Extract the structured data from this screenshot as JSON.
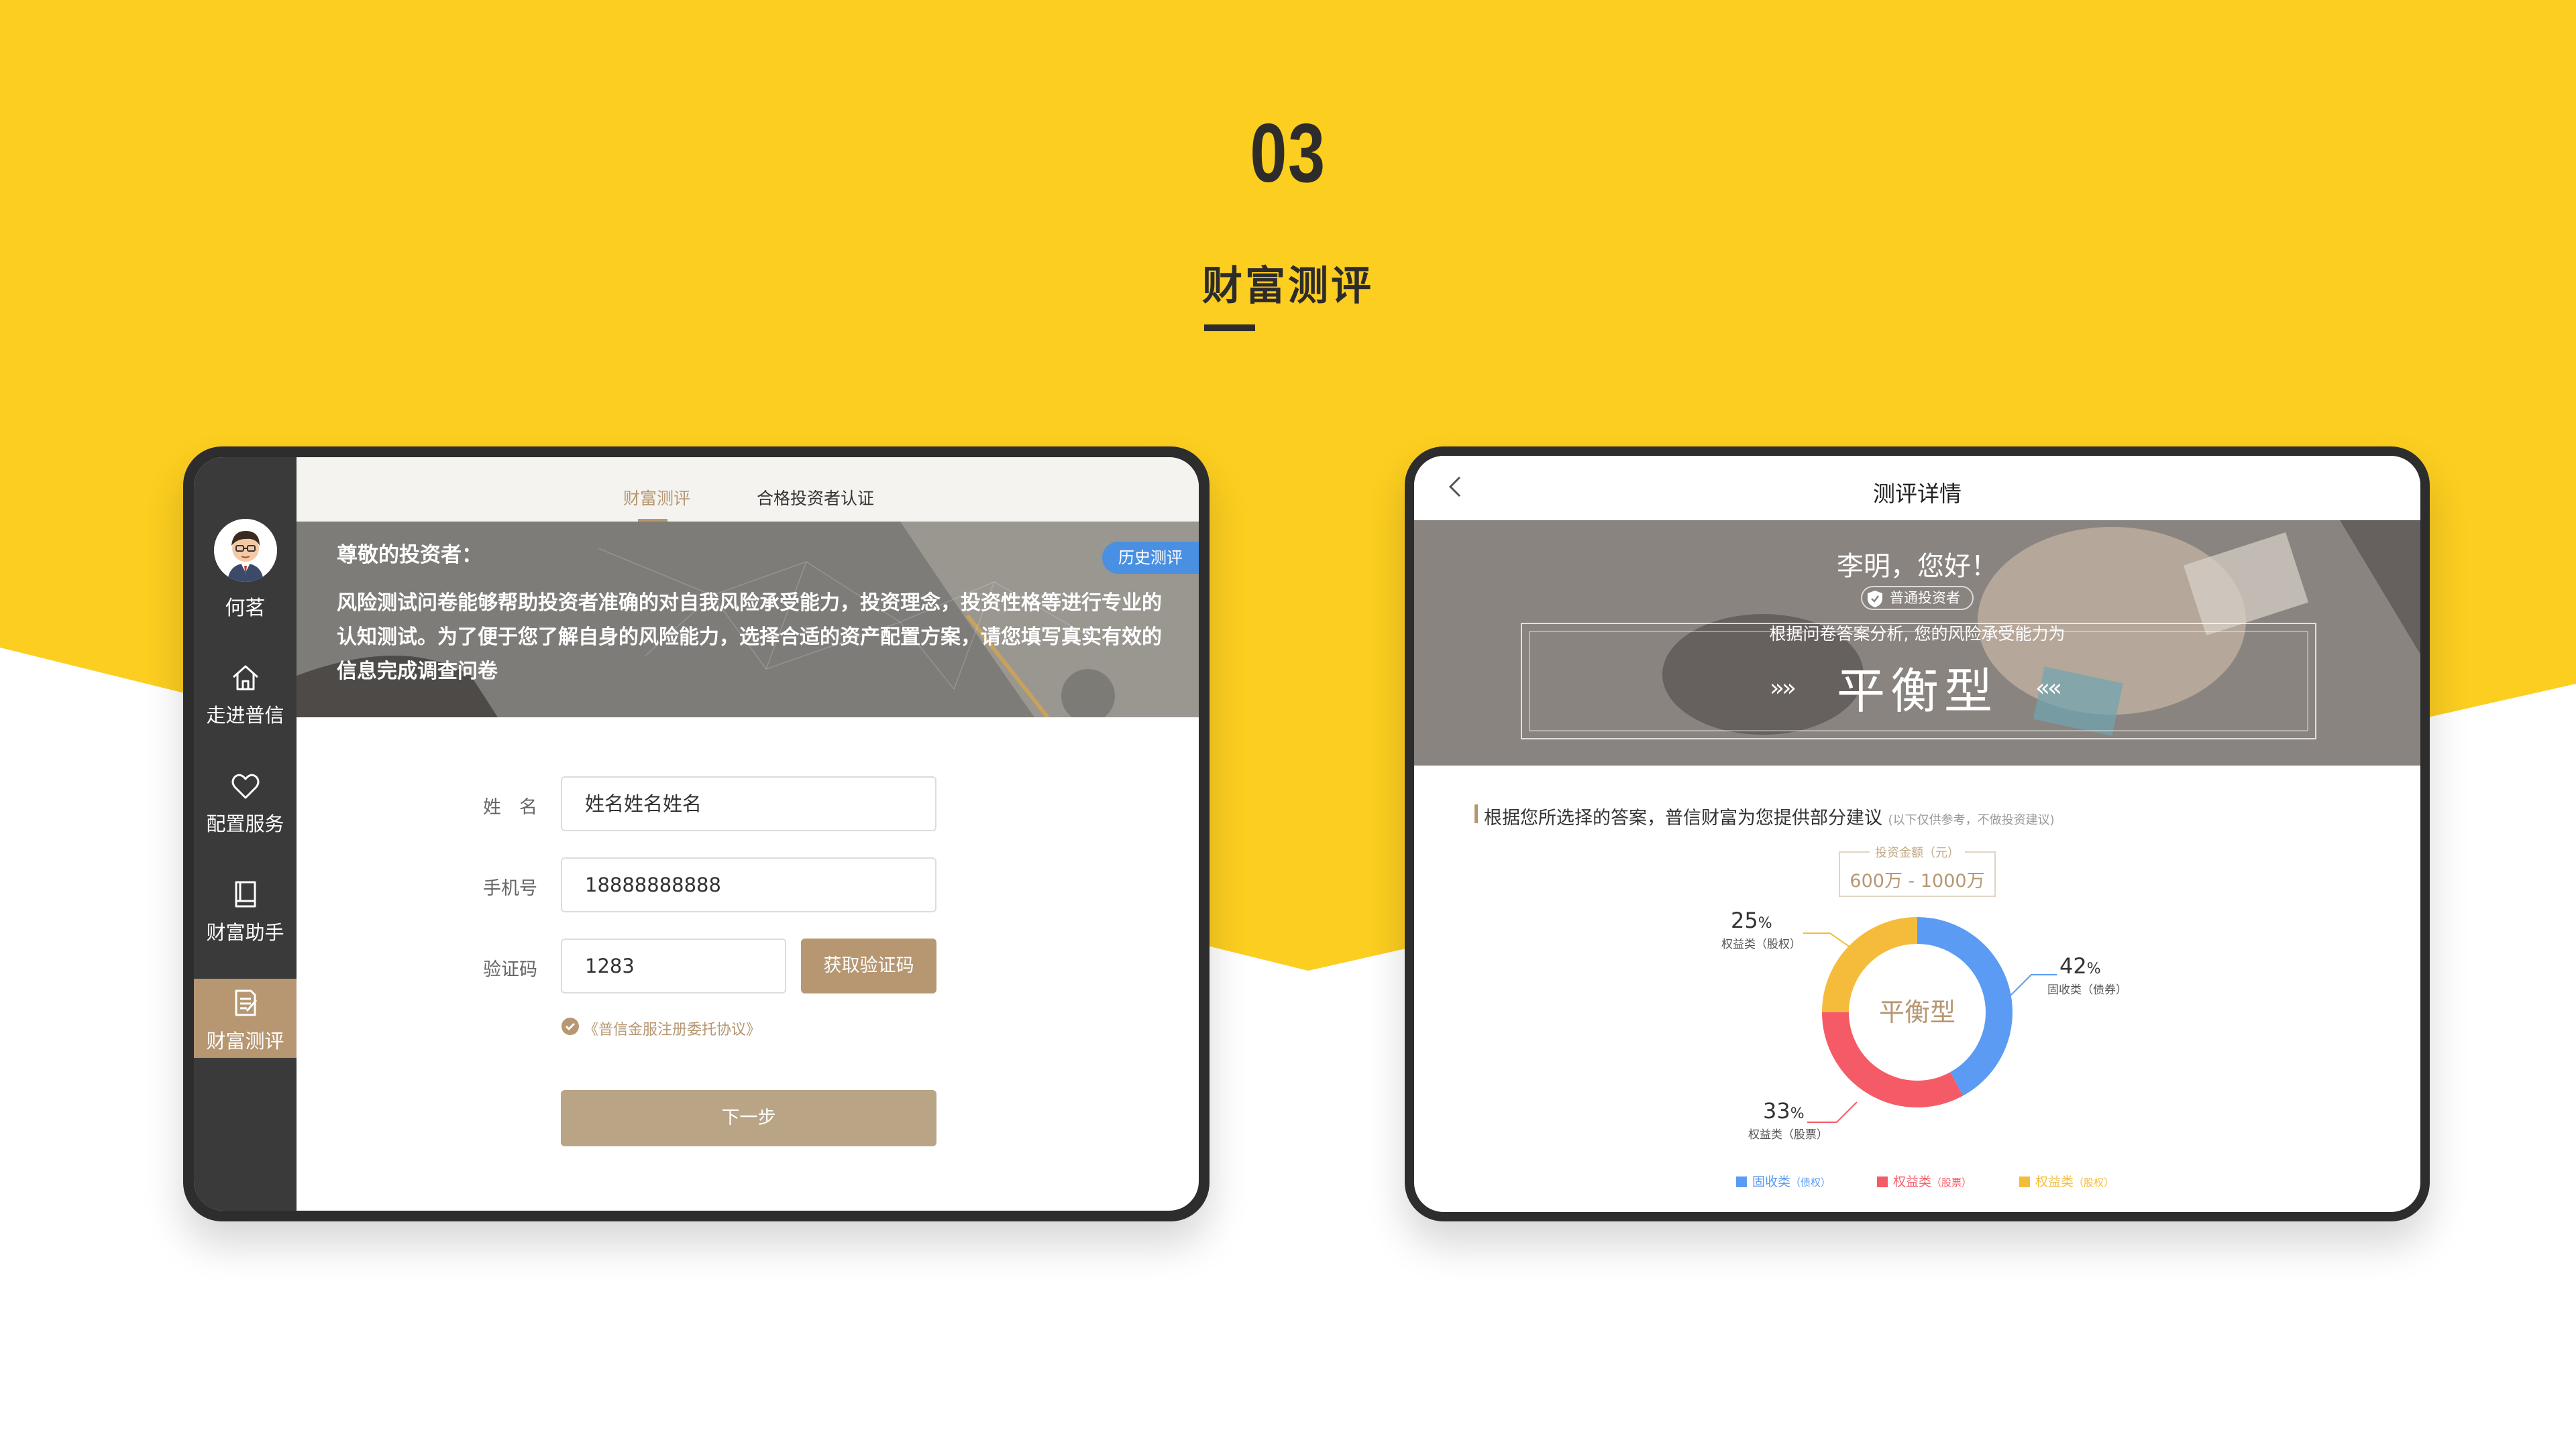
{
  "heading": {
    "number": "03",
    "title": "财富测评"
  },
  "colors": {
    "yellow": "#fcce20",
    "gold": "#b69772",
    "dark": "#2e2c2a",
    "blue": "#5b9bf3",
    "red": "#f55b67",
    "orange": "#f5bc3c"
  },
  "left_screen": {
    "user_name": "何茗",
    "nav": [
      {
        "label": "走进普信",
        "icon": "home-icon"
      },
      {
        "label": "配置服务",
        "icon": "heart-icon"
      },
      {
        "label": "财富助手",
        "icon": "book-icon"
      },
      {
        "label": "财富测评",
        "icon": "edit-icon",
        "active": true
      }
    ],
    "tabs": [
      {
        "label": "财富测评",
        "active": true
      },
      {
        "label": "合格投资者认证"
      }
    ],
    "history_button": "历史测评",
    "greeting": "尊敬的投资者：",
    "intro": "风险测试问卷能够帮助投资者准确的对自我风险承受能力，投资理念，投资性格等进行专业的认知测试。为了便于您了解自身的风险能力，选择合适的资产配置方案，请您填写真实有效的信息完成调查问卷",
    "form": {
      "name_label": "姓　名",
      "name_value": "姓名姓名姓名",
      "phone_label": "手机号",
      "phone_value": "18888888888",
      "code_label": "验证码",
      "code_value": "1283",
      "code_button": "获取验证码",
      "agreement": "《普信金服注册委托协议》",
      "next_button": "下一步"
    }
  },
  "right_screen": {
    "title": "测评详情",
    "hello": "李明，您好！",
    "badge": "普通投资者",
    "desc": "根据问卷答案分析, 您的风险承受能力为",
    "risk_type": "平衡型",
    "advice": "根据您所选择的答案，普信财富为您提供部分建议",
    "advice_note": "(以下仅供参考，不做投资建议)",
    "amount_label": "投资金额（元）",
    "amount_value": "600万 - 1000万",
    "center_label": "平衡型"
  },
  "chart_data": {
    "type": "pie",
    "title": "",
    "slices": [
      {
        "label": "固收类（债券）",
        "value": 42,
        "pct": "42",
        "color": "#5b9bf3"
      },
      {
        "label": "权益类（股票）",
        "value": 33,
        "pct": "33",
        "color": "#f55b67"
      },
      {
        "label": "权益类（股权）",
        "value": 25,
        "pct": "25",
        "color": "#f5bc3c"
      }
    ],
    "legend": [
      {
        "name": "固收类",
        "note": "（债权）",
        "color": "#5b9bf3"
      },
      {
        "name": "权益类",
        "note": "（股票）",
        "color": "#f55b67"
      },
      {
        "name": "权益类",
        "note": "（股权）",
        "color": "#f5bc3c"
      }
    ],
    "percent_sign": "%"
  }
}
